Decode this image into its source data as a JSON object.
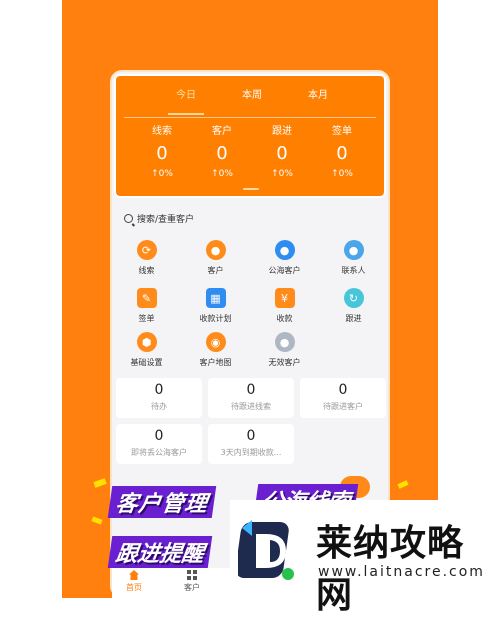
{
  "stats": {
    "tabs": [
      "今日",
      "本周",
      "本月"
    ],
    "active_tab": 0,
    "metrics": [
      {
        "label": "线索",
        "value": "0",
        "change": "↑0%"
      },
      {
        "label": "客户",
        "value": "0",
        "change": "↑0%"
      },
      {
        "label": "跟进",
        "value": "0",
        "change": "↑0%"
      },
      {
        "label": "签单",
        "value": "0",
        "change": "↑0%"
      }
    ]
  },
  "search": {
    "label": "搜索/查重客户"
  },
  "grid": [
    {
      "label": "线索",
      "icon": "link-icon"
    },
    {
      "label": "客户",
      "icon": "customer-icon"
    },
    {
      "label": "公海客户",
      "icon": "public-customer-icon"
    },
    {
      "label": "联系人",
      "icon": "contact-icon"
    },
    {
      "label": "签单",
      "icon": "contract-icon"
    },
    {
      "label": "收款计划",
      "icon": "payment-plan-icon"
    },
    {
      "label": "收款",
      "icon": "payment-icon"
    },
    {
      "label": "跟进",
      "icon": "followup-icon"
    },
    {
      "label": "基础设置",
      "icon": "settings-icon"
    },
    {
      "label": "客户地图",
      "icon": "map-pin-icon"
    },
    {
      "label": "无效客户",
      "icon": "invalid-customer-icon"
    }
  ],
  "counters": [
    {
      "value": "0",
      "label": "待办"
    },
    {
      "value": "0",
      "label": "待跟进线索"
    },
    {
      "value": "0",
      "label": "待跟进客户"
    },
    {
      "value": "0",
      "label": "即将丢公海客户"
    },
    {
      "value": "0",
      "label": "3天内到期收款..."
    }
  ],
  "banners": {
    "customer_management": "客户管理",
    "public_leads": "公海线索",
    "followup_reminder": "跟进提醒"
  },
  "bottom_nav": [
    {
      "label": "首页",
      "icon": "home-icon"
    },
    {
      "label": "客户",
      "icon": "grid-icon"
    }
  ],
  "watermark": {
    "title": "莱纳攻略网",
    "url": "www.laitnacre.com"
  }
}
